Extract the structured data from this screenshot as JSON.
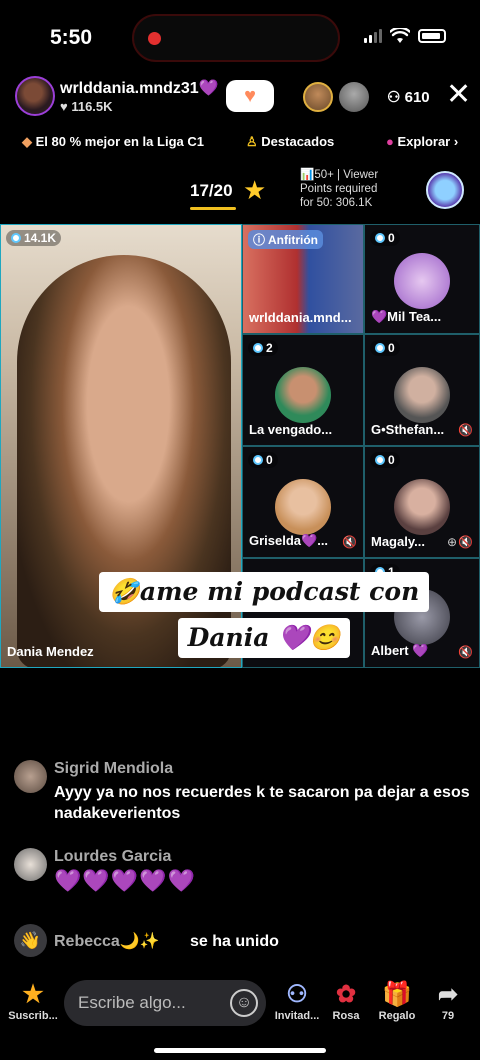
{
  "status": {
    "time": "5:50"
  },
  "host": {
    "name": "wrlddania.mndz31💜",
    "likes": "♥ 116.5K",
    "viewer_count": "610"
  },
  "info_row": {
    "league": "El 80 % mejor en la Liga C1",
    "featured": "Destacados",
    "explore": "Explorar ›"
  },
  "rank": {
    "position": "17/20",
    "points_line1": "📊50+ | Viewer",
    "points_line2": "Points required",
    "points_line3": "for 50: 306.1K"
  },
  "main_guest": {
    "count": "14.1K",
    "name": "Dania Mendez"
  },
  "host_cell": {
    "tag": "Anfitrión",
    "name": "wrlddania.mnd..."
  },
  "guests": [
    {
      "count": "0",
      "name": "💜Mil Tea...",
      "color": "#c9a0e6"
    },
    {
      "count": "2",
      "name": "La vengado...",
      "color": "#2f8a5a"
    },
    {
      "count": "0",
      "name": "G•Sthefan...",
      "color": "#8a8a8a"
    },
    {
      "count": "0",
      "name": "Griselda💜...",
      "color": "#d8a070"
    },
    {
      "count": "0",
      "name": "Magaly...",
      "color": "#b08878"
    },
    {
      "count": "1",
      "name": "Albert 💜",
      "color": "#5a5a66"
    }
  ],
  "overlay": {
    "line1": "🤣ame mi podcast con",
    "line2": "Dania 💜😊"
  },
  "comments": [
    {
      "name": "Sigrid Mendiola",
      "text": "Ayyy ya no nos recuerdes k te sacaron pa dejar a esos nadakeverientos"
    },
    {
      "name": "Lourdes Garcia",
      "text": "💜💜💜💜💜"
    },
    {
      "name": "Rebecca🌙✨",
      "text": "se ha unido"
    }
  ],
  "bottom": {
    "subscribe": "Suscrib...",
    "placeholder": "Escribe algo...",
    "invite": "Invitad...",
    "rose": "Rosa",
    "gift": "Regalo",
    "share_count": "79"
  }
}
